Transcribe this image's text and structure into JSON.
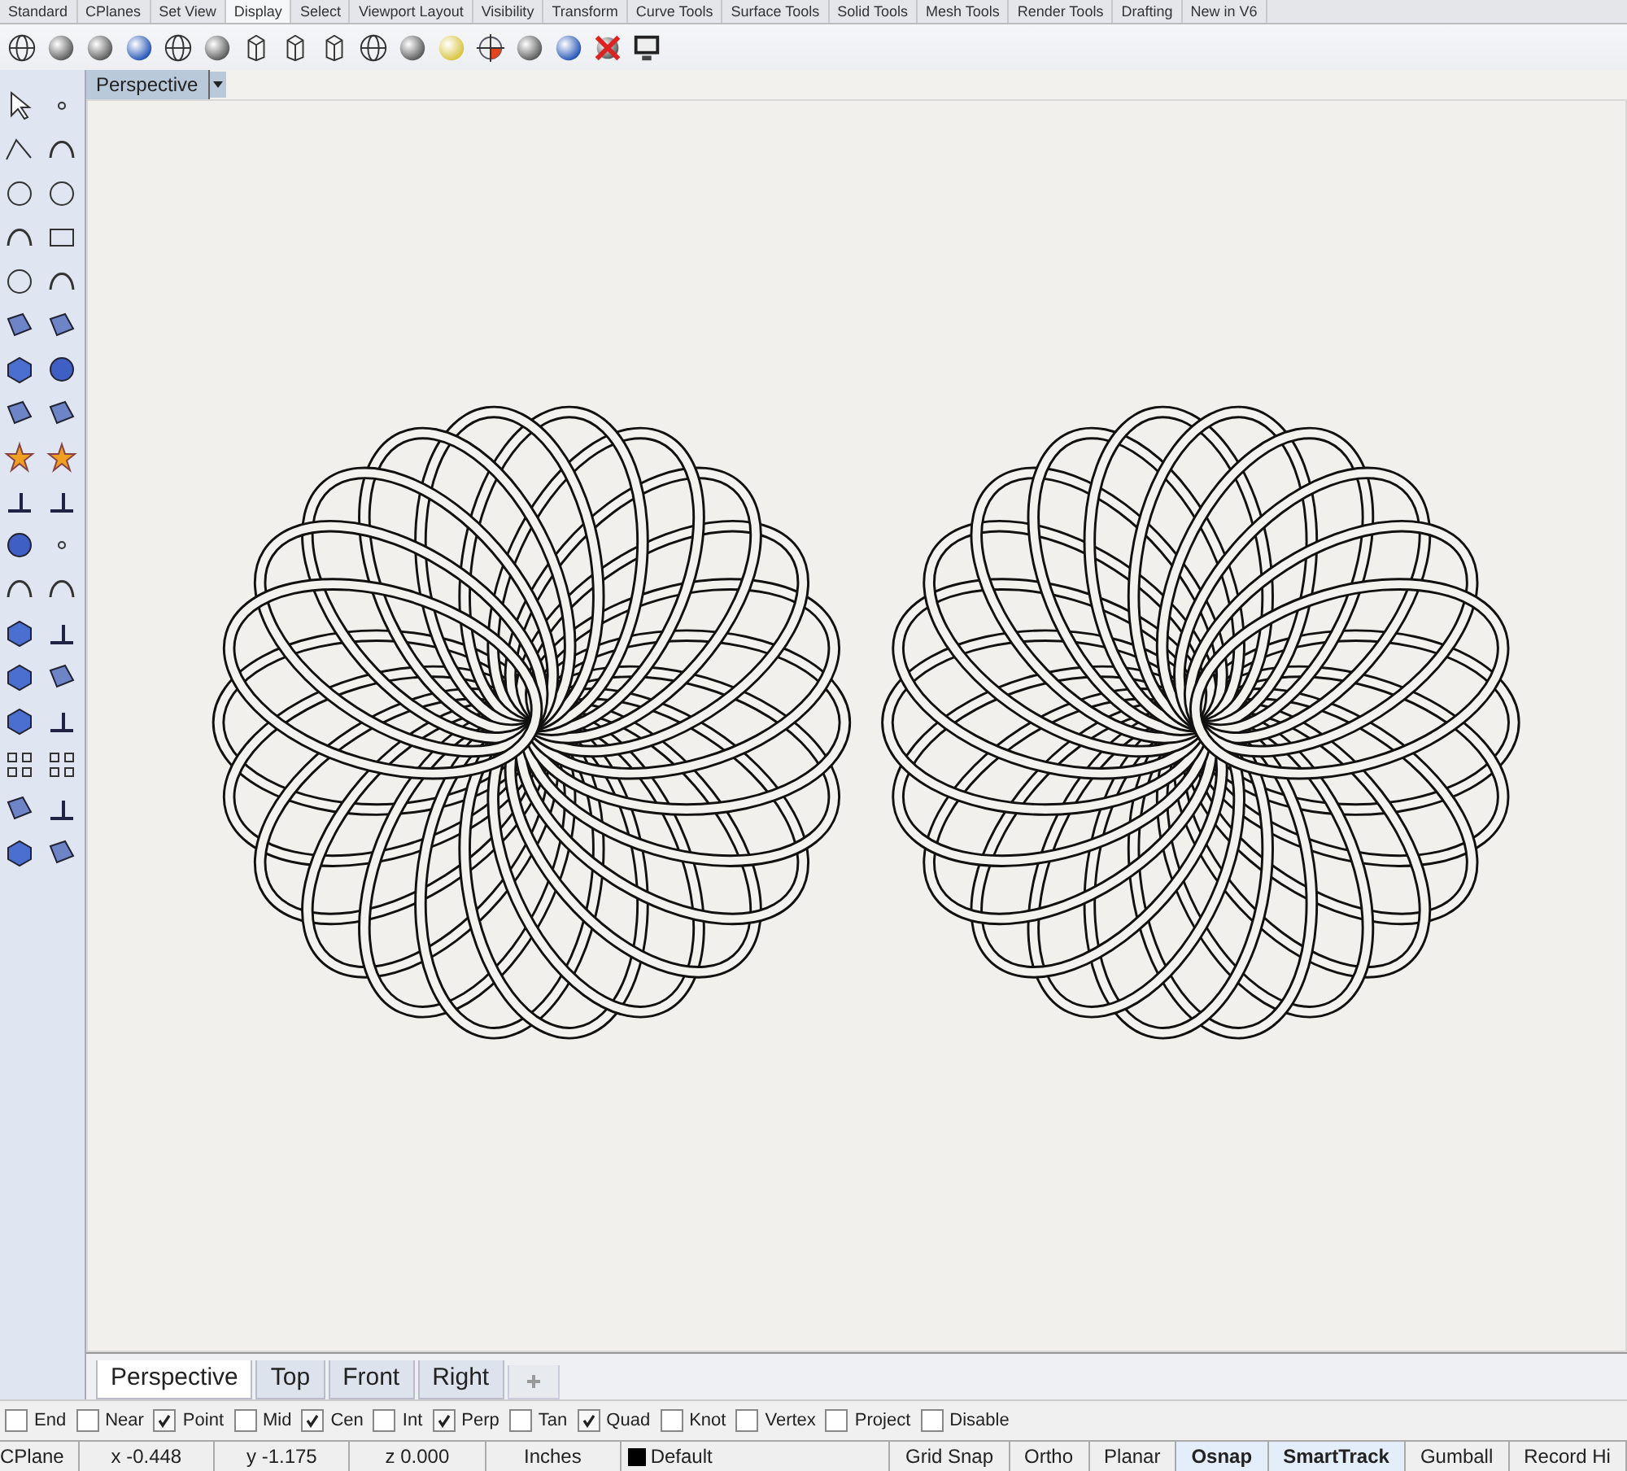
{
  "ribbon_tabs": [
    {
      "label": "Standard",
      "selected": false
    },
    {
      "label": "CPlanes",
      "selected": false
    },
    {
      "label": "Set View",
      "selected": false
    },
    {
      "label": "Display",
      "selected": true
    },
    {
      "label": "Select",
      "selected": false
    },
    {
      "label": "Viewport Layout",
      "selected": false
    },
    {
      "label": "Visibility",
      "selected": false
    },
    {
      "label": "Transform",
      "selected": false
    },
    {
      "label": "Curve Tools",
      "selected": false
    },
    {
      "label": "Surface Tools",
      "selected": false
    },
    {
      "label": "Solid Tools",
      "selected": false
    },
    {
      "label": "Mesh Tools",
      "selected": false
    },
    {
      "label": "Render Tools",
      "selected": false
    },
    {
      "label": "Drafting",
      "selected": false
    },
    {
      "label": "New in V6",
      "selected": false
    }
  ],
  "viewport": {
    "title": "Perspective"
  },
  "viewport_tabs": [
    {
      "label": "Perspective",
      "selected": true
    },
    {
      "label": "Top",
      "selected": false
    },
    {
      "label": "Front",
      "selected": false
    },
    {
      "label": "Right",
      "selected": false
    }
  ],
  "osnaps": [
    {
      "label": "End",
      "checked": false
    },
    {
      "label": "Near",
      "checked": false
    },
    {
      "label": "Point",
      "checked": true
    },
    {
      "label": "Mid",
      "checked": false
    },
    {
      "label": "Cen",
      "checked": true
    },
    {
      "label": "Int",
      "checked": false
    },
    {
      "label": "Perp",
      "checked": true
    },
    {
      "label": "Tan",
      "checked": false
    },
    {
      "label": "Quad",
      "checked": true
    },
    {
      "label": "Knot",
      "checked": false
    },
    {
      "label": "Vertex",
      "checked": false
    },
    {
      "label": "Project",
      "checked": false
    },
    {
      "label": "Disable",
      "checked": false
    }
  ],
  "status": {
    "cplane": "CPlane",
    "x": "x -0.448",
    "y": "y -1.175",
    "z": "z 0.000",
    "units": "Inches",
    "layer": "Default"
  },
  "toggles": [
    {
      "label": "Grid Snap",
      "on": false
    },
    {
      "label": "Ortho",
      "on": false
    },
    {
      "label": "Planar",
      "on": false
    },
    {
      "label": "Osnap",
      "on": true
    },
    {
      "label": "SmartTrack",
      "on": true
    },
    {
      "label": "Gumball",
      "on": false
    },
    {
      "label": "Record Hi",
      "on": false
    }
  ]
}
